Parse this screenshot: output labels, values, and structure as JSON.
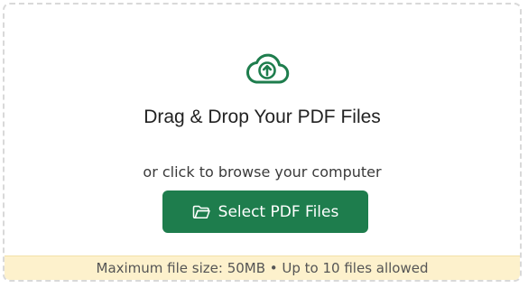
{
  "dropzone": {
    "title": "Drag & Drop Your PDF Files",
    "subtitle": "or click to browse your computer",
    "button_label": "Select PDF Files",
    "info_text": "Maximum file size: 50MB • Up to 10 files allowed"
  },
  "icons": {
    "upload": "cloud-upload-icon",
    "folder": "folder-icon"
  },
  "colors": {
    "accent": "#1e7d4d",
    "info_bg": "#fdf1cc",
    "border": "#d9d9d9"
  }
}
